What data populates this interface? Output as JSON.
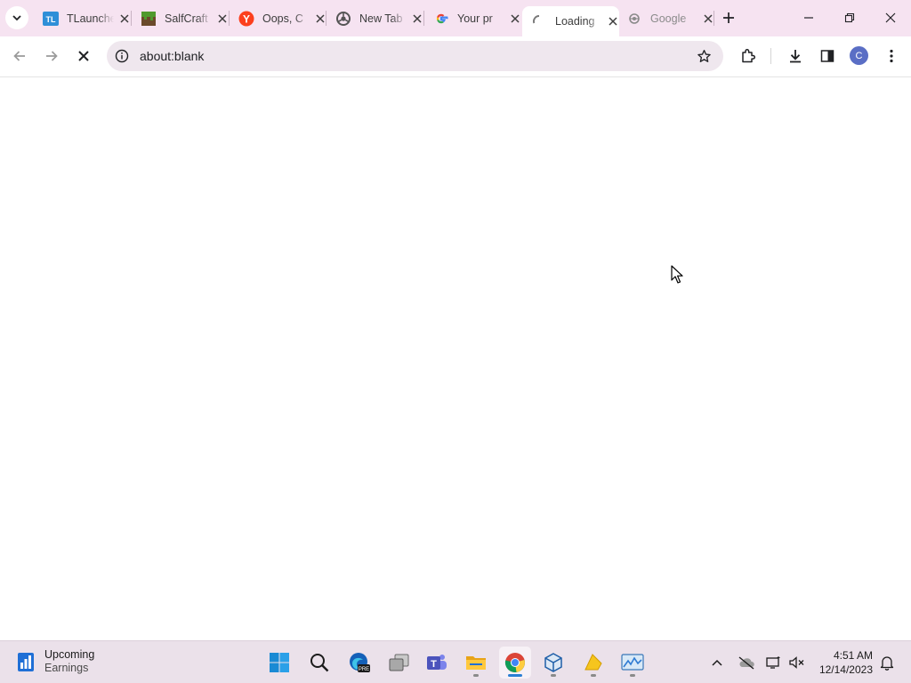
{
  "browser": {
    "tabs": [
      {
        "title": "TLauncher",
        "favicon": "tlauncher-icon",
        "active": false
      },
      {
        "title": "SalfCraft",
        "favicon": "minecraft-block-icon",
        "active": false
      },
      {
        "title": "Oops, C",
        "favicon": "yandex-icon",
        "active": false
      },
      {
        "title": "New Tab",
        "favicon": "chrome-icon",
        "active": false
      },
      {
        "title": "Your pr",
        "favicon": "google-icon",
        "active": false
      },
      {
        "title": "Loading",
        "favicon": "loading-spinner-icon",
        "active": true
      },
      {
        "title": "Google",
        "favicon": "loading-globe-icon",
        "active": false
      }
    ],
    "omnibox": {
      "url": "about:blank"
    },
    "profile_initial": "C",
    "colors": {
      "tabstrip": "#f6e3f1",
      "omnibox": "#efe7ee",
      "accent": "#5a6ec5"
    }
  },
  "taskbar": {
    "widget": {
      "title": "Upcoming",
      "subtitle": "Earnings"
    },
    "apps": [
      "windows-start-icon",
      "search-icon",
      "edge-dev-icon",
      "task-view-icon",
      "teams-icon",
      "file-explorer-icon",
      "chrome-icon",
      "virtualbox-icon",
      "sticky-app-icon",
      "stock-app-icon"
    ],
    "clock": {
      "time": "4:51 AM",
      "date": "12/14/2023"
    }
  }
}
